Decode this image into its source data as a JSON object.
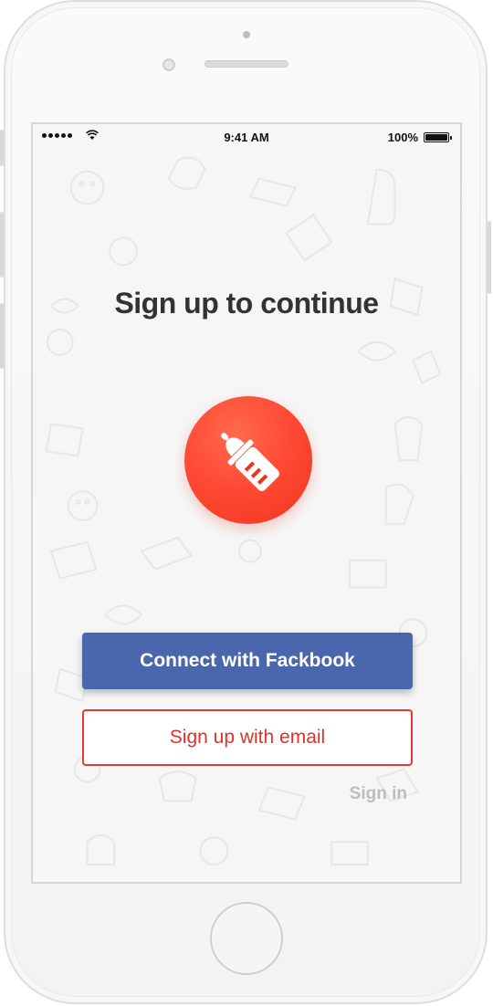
{
  "status_bar": {
    "time": "9:41 AM",
    "battery_percent": "100%",
    "icons": [
      "signal-dots-icon",
      "wifi-icon",
      "battery-icon"
    ]
  },
  "screen": {
    "title": "Sign up to continue",
    "logo_icon": "baby-bottle-icon",
    "facebook_button_label": "Connect with Fackbook",
    "email_button_label": "Sign up with email",
    "sign_in_label": "Sign in"
  },
  "colors": {
    "facebook_blue": "#4a66ad",
    "accent_red": "#e33127",
    "logo_red": "#ff4b35",
    "muted_gray": "#bdbdbd"
  }
}
